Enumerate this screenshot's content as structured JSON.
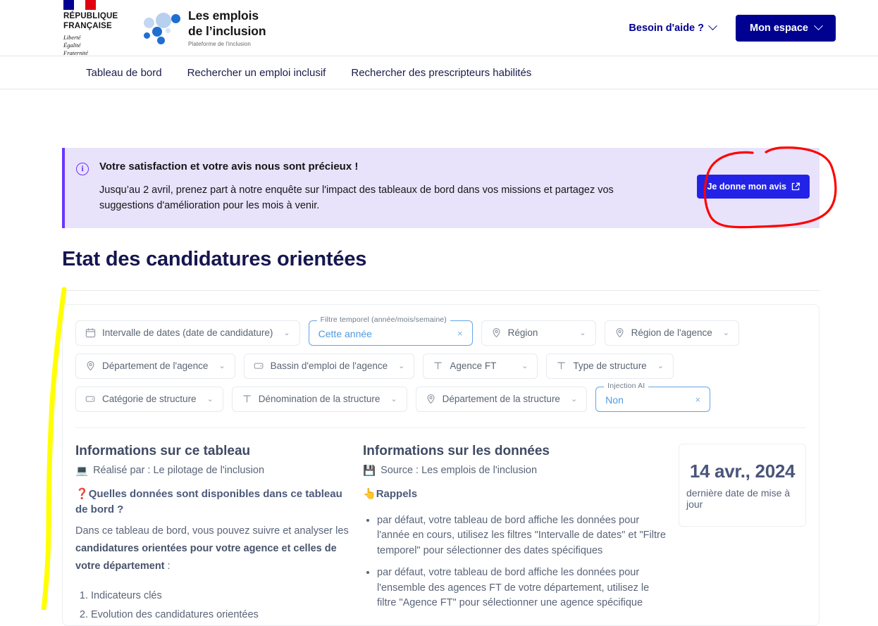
{
  "header": {
    "republic": {
      "line1": "RÉPUBLIQUE",
      "line2": "FRANÇAISE",
      "devise1": "Liberté",
      "devise2": "Égalité",
      "devise3": "Fraternité"
    },
    "brand": {
      "line1": "Les emplois",
      "line2": "de l’inclusion",
      "tagline": "Plateforme de l'inclusion"
    },
    "help_label": "Besoin d'aide ?",
    "account_label": "Mon espace"
  },
  "nav": {
    "items": [
      {
        "label": "Tableau de bord"
      },
      {
        "label": "Rechercher un emploi inclusif"
      },
      {
        "label": "Rechercher des prescripteurs habilités"
      }
    ]
  },
  "notice": {
    "icon": "info-icon",
    "title": "Votre satisfaction et votre avis nous sont précieux !",
    "text": "Jusqu’au 2 avril, prenez part à notre enquête sur l'impact des tableaux de bord dans vos missions et partagez vos suggestions d'amélioration pour les mois à venir.",
    "cta_label": "Je donne mon avis",
    "cta_icon": "external-link-icon",
    "bg_color": "#e9e2fb",
    "accent_color": "#6a36ff",
    "cta_color": "#2323e8"
  },
  "page_title": "Etat des candidatures orientées",
  "filters": [
    {
      "label": "Intervalle de dates (date de candidature)",
      "icon": "calendar-icon",
      "state": "idle",
      "width": "w1"
    },
    {
      "legend": "Filtre temporel (année/mois/semaine)",
      "value": "Cette année",
      "state": "active",
      "clear": "×",
      "width": "w2"
    },
    {
      "label": "Région",
      "icon": "pin-icon",
      "state": "idle",
      "width": "w3"
    },
    {
      "label": "Région de l'agence",
      "icon": "pin-icon",
      "state": "idle",
      "width": ""
    },
    {
      "label": "Département de l'agence",
      "icon": "pin-icon",
      "state": "idle",
      "width": ""
    },
    {
      "label": "Bassin d'emploi de l'agence",
      "icon": "tag-icon",
      "state": "idle",
      "width": ""
    },
    {
      "label": "Agence FT",
      "icon": "text-icon",
      "state": "idle",
      "width": "w3"
    },
    {
      "label": "Type de structure",
      "icon": "text-icon",
      "state": "idle",
      "width": ""
    },
    {
      "label": "Catégorie de structure",
      "icon": "tag-icon",
      "state": "idle",
      "width": ""
    },
    {
      "label": "Dénomination de la structure",
      "icon": "text-icon",
      "state": "idle",
      "width": ""
    },
    {
      "label": "Département de la structure",
      "icon": "pin-icon",
      "state": "idle",
      "width": ""
    },
    {
      "legend": "Injection AI",
      "value": "Non",
      "state": "active",
      "clear": "×",
      "width": "w3"
    }
  ],
  "card_table": {
    "heading": "Informations sur ce tableau",
    "author_icon": "laptop-icon",
    "author_line": "Réalisé par : Le pilotage de l'inclusion",
    "question_icon": "question-mark-icon",
    "question": "Quelles données sont disponibles dans ce tableau de bord ?",
    "paragraph_pre": "Dans ce tableau de bord, vous pouvez suivre et analyser les ",
    "paragraph_bold": "candidatures orientées pour votre agence et celles de votre département",
    "paragraph_post": " :",
    "list": [
      "Indicateurs clés",
      "Evolution des candidatures orientées"
    ]
  },
  "card_data": {
    "heading": "Informations sur les données",
    "source_icon": "floppy-disk-icon",
    "source_line": "Source : Les emplois de l'inclusion",
    "reminder_icon": "pointing-hand-icon",
    "reminder_title": "Rappels",
    "bullets": [
      "par défaut, votre tableau de bord affiche les données pour l'année en cours, utilisez les filtres \"Intervalle de dates\" et \"Filtre temporel\" pour sélectionner des dates spécifiques",
      "par défaut, votre tableau de bord affiche les données pour l'ensemble des agences FT de votre département, utilisez le filtre \"Agence FT\" pour sélectionner une agence spécifique"
    ]
  },
  "card_date": {
    "date": "14 avr., 2024",
    "caption": "dernière date de mise à jour"
  },
  "annotations": {
    "red_circle_color": "#ff0000",
    "yellow_stroke_color": "#ffff00"
  }
}
